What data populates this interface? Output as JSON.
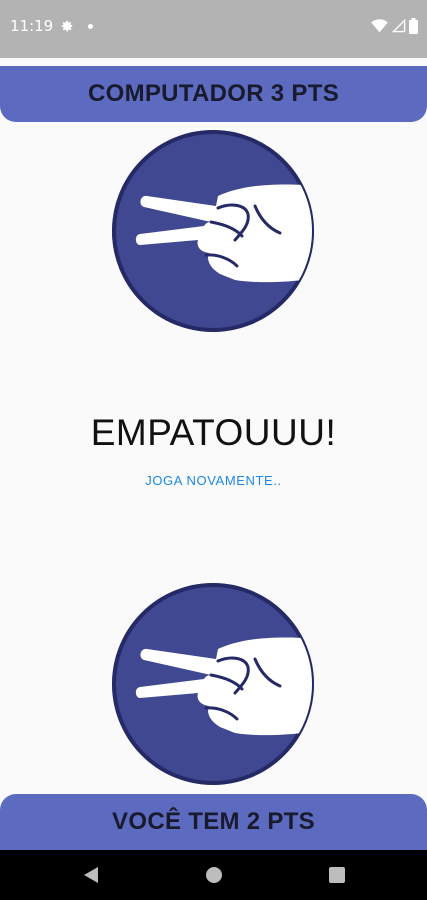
{
  "status_bar": {
    "time": "11:19",
    "icons": [
      "gear-icon",
      "notification-dot-icon",
      "wifi-icon",
      "signal-icon",
      "battery-icon"
    ]
  },
  "header": {
    "computer_score": "COMPUTADOR 3 PTS"
  },
  "game": {
    "computer_choice_icon": "scissors-hand-icon",
    "result": "EMPATOUUU!",
    "play_again_label": "JOGA NOVAMENTE..",
    "player_choice_icon": "scissors-hand-icon"
  },
  "footer": {
    "player_score": "VOCÊ TEM 2 PTS"
  },
  "colors": {
    "accent": "#5c6bc0",
    "hand_circle": "#3f4891",
    "link": "#1e88e5"
  }
}
